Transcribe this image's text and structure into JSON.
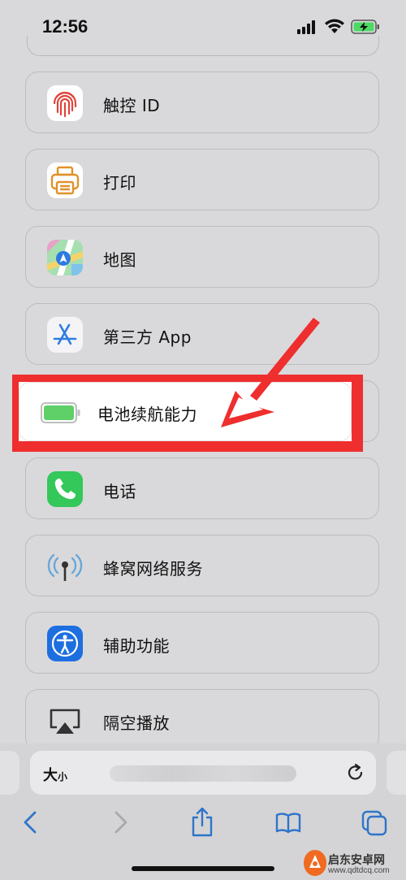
{
  "status_bar": {
    "time": "12:56"
  },
  "settings_list": [
    {
      "label": "触控 ID"
    },
    {
      "label": "打印"
    },
    {
      "label": "地图"
    },
    {
      "label": "第三方 App"
    },
    {
      "label": "电池续航能力"
    },
    {
      "label": "电话"
    },
    {
      "label": "蜂窝网络服务"
    },
    {
      "label": "辅助功能"
    },
    {
      "label": "隔空播放"
    }
  ],
  "address_bar": {
    "text_size_button": "大",
    "text_size_small": "小"
  },
  "toolbar": {
    "items": [
      "back",
      "forward",
      "share",
      "bookmarks",
      "tabs"
    ]
  },
  "watermark": {
    "text": "启东安卓网",
    "url": "www.qdtdcq.com"
  },
  "colors": {
    "highlight": "#ef2e2e",
    "battery_green": "#4cd964",
    "phone_green": "#34c759",
    "accessibility_blue": "#1d6fe0",
    "toolbar_blue": "#2f74c9"
  }
}
